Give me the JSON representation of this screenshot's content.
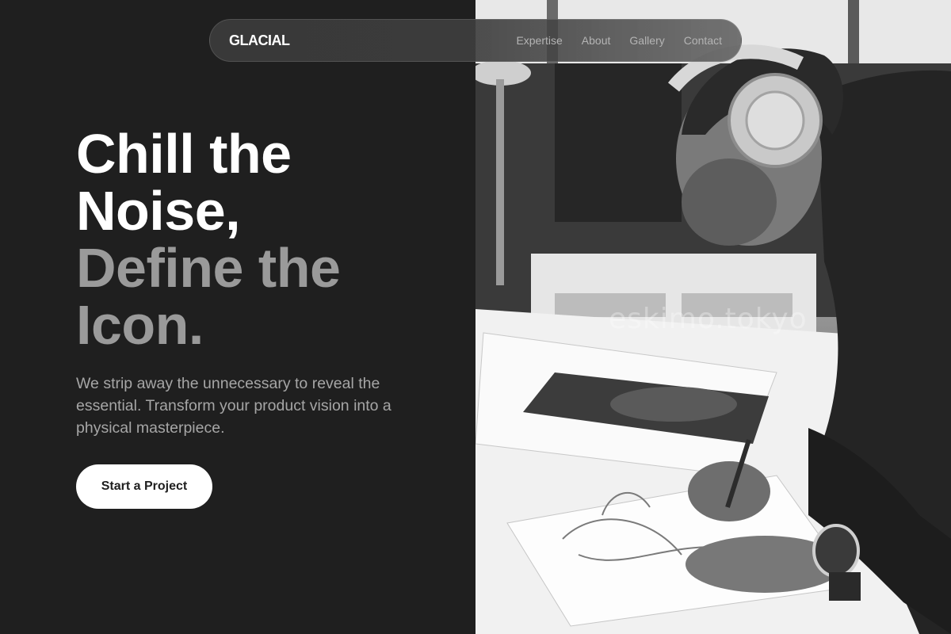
{
  "nav": {
    "brand": "GLACIAL",
    "links": [
      "Expertise",
      "About",
      "Gallery",
      "Contact"
    ]
  },
  "hero": {
    "headline_primary": "Chill the Noise,",
    "headline_secondary": "Define the Icon.",
    "subtext": "We strip away the unnecessary to reveal the essential. Transform your product vision into a physical masterpiece.",
    "cta_label": "Start a Project"
  },
  "image": {
    "watermark": "eskimo.tokyo",
    "subject": "designer-sketching-with-headphones-photo"
  },
  "colors": {
    "background": "#1f1f1f",
    "text_primary": "#ffffff",
    "text_muted": "#9a9a9a",
    "nav_link": "#b4b4b4",
    "cta_background": "#ffffff"
  }
}
